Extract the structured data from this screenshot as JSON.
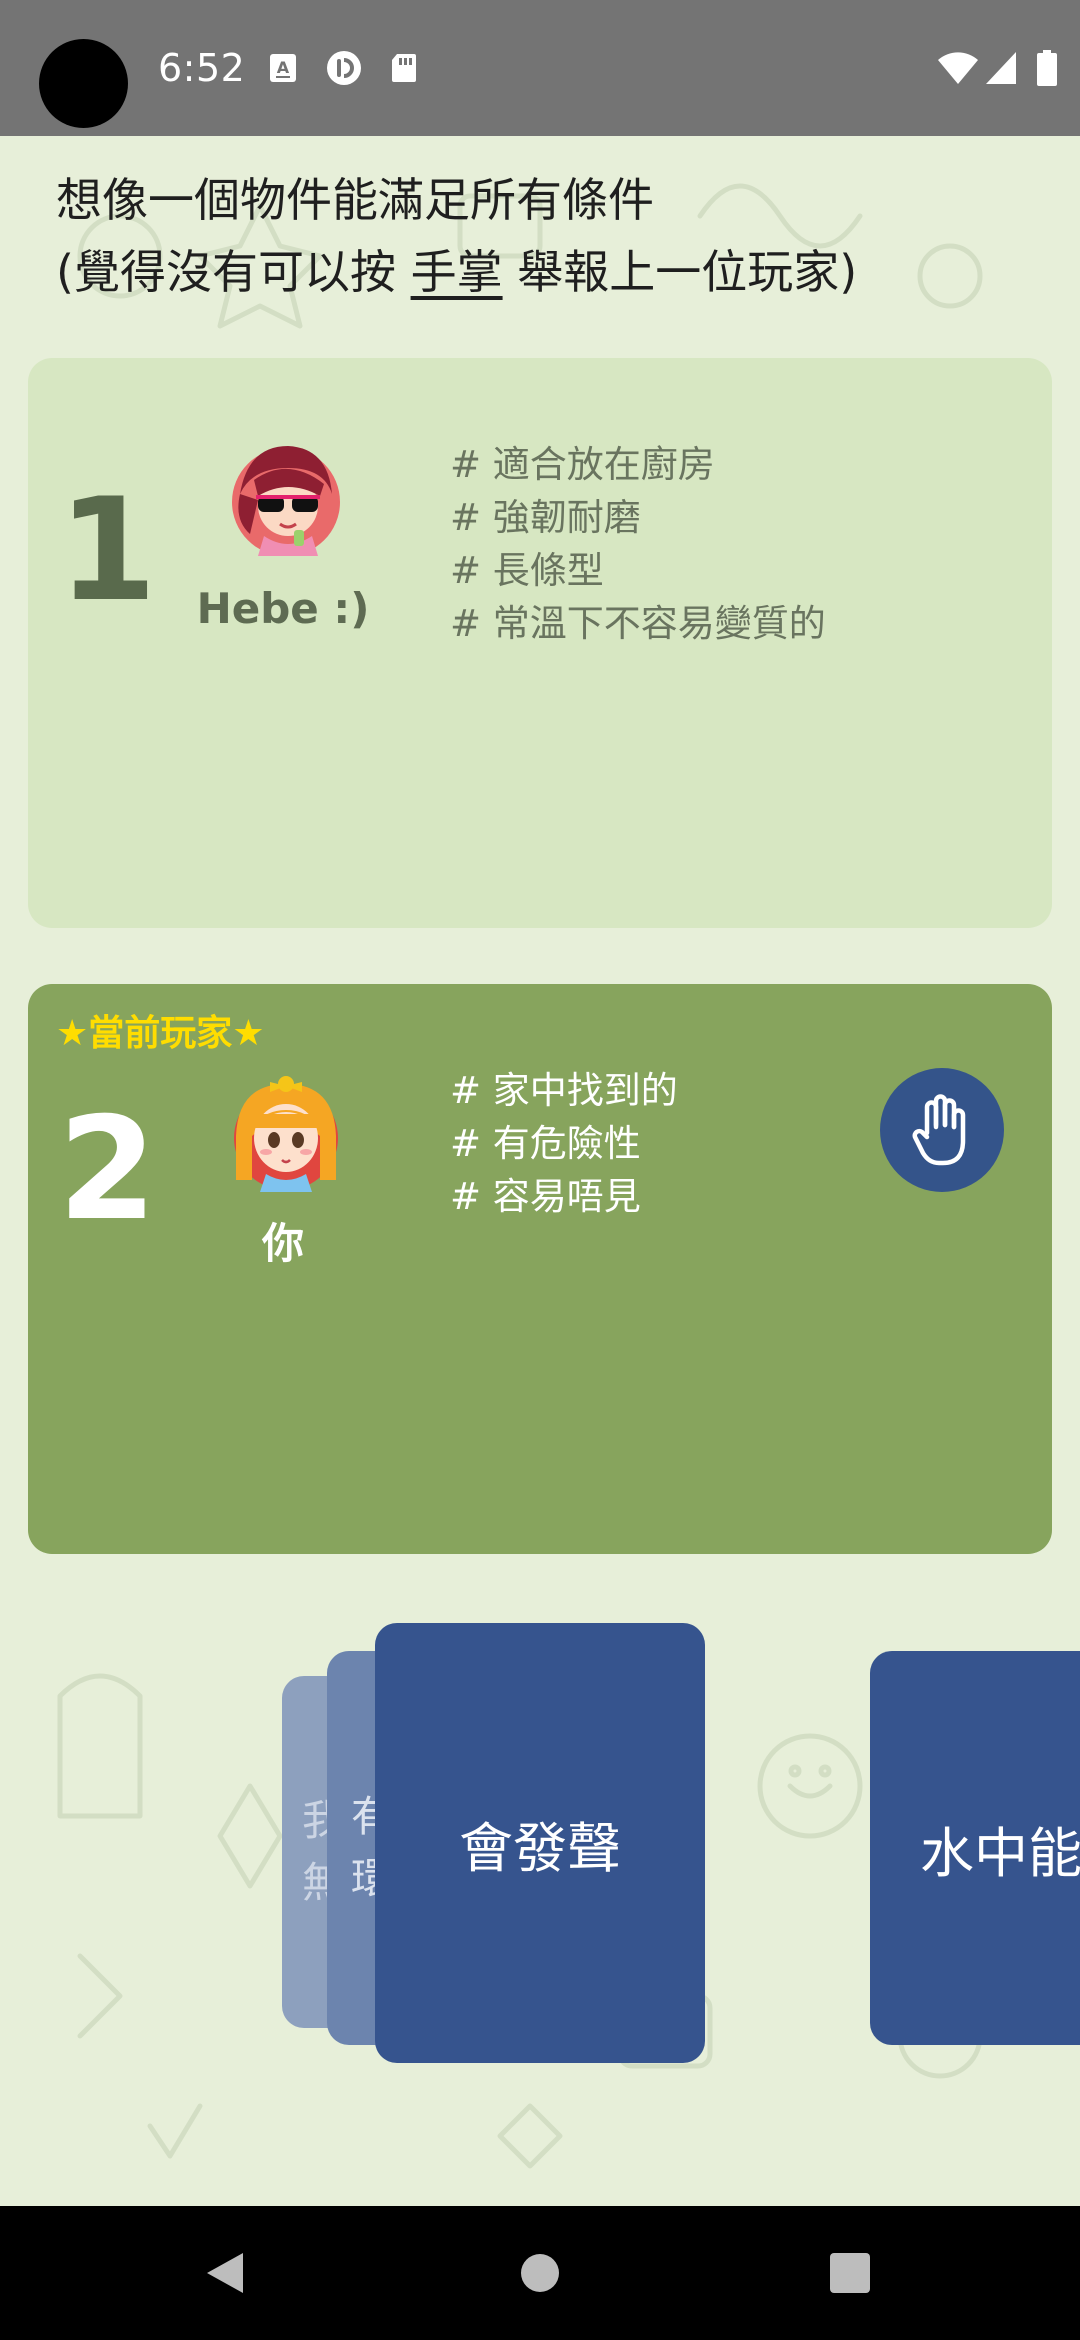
{
  "status_bar": {
    "time": "6:52",
    "left_icons": [
      "keyboard-a-icon",
      "cast-icon",
      "sd-card-icon"
    ],
    "right_icons": [
      "wifi-icon",
      "cell-signal-icon",
      "battery-icon"
    ]
  },
  "instruction": {
    "line1": "想像一個物件能滿足所有條件",
    "line2_prefix": "(覺得沒有可以按 ",
    "line2_link": "手掌",
    "line2_suffix": " 舉報上一位玩家)"
  },
  "players": [
    {
      "number": "1",
      "name": "Hebe :)",
      "avatar": "girl-sunglasses-avatar",
      "hints": [
        "# 適合放在廚房",
        "# 強韌耐磨",
        "# 長條型",
        "# 常溫下不容易變質的"
      ]
    },
    {
      "current_label": "★當前玩家★",
      "number": "2",
      "name": "你",
      "avatar": "girl-orange-hair-avatar",
      "hints": [
        "# 家中找到的",
        "# 有危險性",
        "# 容易唔見"
      ],
      "report_icon": "hand-icon"
    }
  ],
  "cards": {
    "stack_back_2": "我 無",
    "stack_back_2_line1": "我",
    "stack_back_2_line2": "無",
    "stack_back_1_line1": "有",
    "stack_back_1_line2": "環",
    "front": "會發聲",
    "next": "水中能用"
  },
  "colors": {
    "card1_bg": "#d7e7c2",
    "card2_bg": "#87a45d",
    "card_blue": "#36548e",
    "current_label": "#ffdd00"
  },
  "nav": {
    "icons": [
      "back-icon",
      "home-icon",
      "recents-icon"
    ]
  }
}
